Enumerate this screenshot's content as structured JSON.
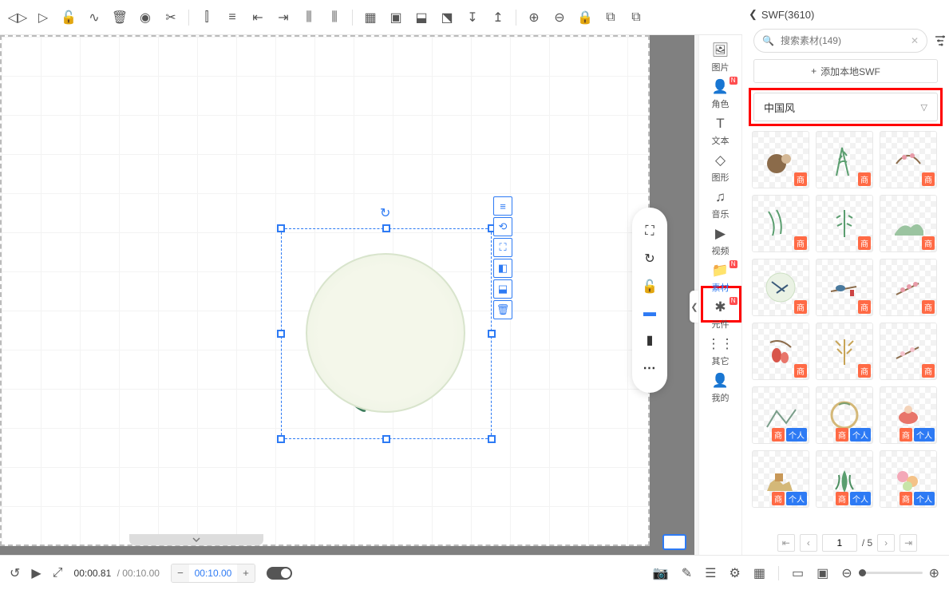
{
  "toolbar_icons": [
    "flip-h",
    "play-triangle",
    "lock-open",
    "curve",
    "trash",
    "focus",
    "crop",
    "align-v",
    "align-h",
    "indent-l",
    "indent-r",
    "distribute-h",
    "distribute-v",
    "group",
    "ungroup",
    "send-back",
    "bring-front",
    "move-back",
    "move-front",
    "zoom-in",
    "zoom-out",
    "lock",
    "copy",
    "paste"
  ],
  "right_nav": [
    {
      "icon": "🖼",
      "label": "图片"
    },
    {
      "icon": "👤",
      "label": "角色",
      "hot": "N"
    },
    {
      "icon": "T",
      "label": "文本"
    },
    {
      "icon": "◇",
      "label": "图形"
    },
    {
      "icon": "♫",
      "label": "音乐"
    },
    {
      "icon": "▶",
      "label": "视频"
    },
    {
      "icon": "📁",
      "label": "素材",
      "hot": "N",
      "active": true
    },
    {
      "icon": "✱",
      "label": "元件",
      "hot": "N"
    },
    {
      "icon": "⋮⋮",
      "label": "其它"
    },
    {
      "icon": "👤",
      "label": "我的"
    }
  ],
  "float_tools": [
    "≡",
    "⟲",
    "⛶",
    "◧",
    "⬓",
    "🗑"
  ],
  "mid_panel": [
    "⛶",
    "↻",
    "🔓",
    "▬",
    "▮",
    "⋯"
  ],
  "asset_panel": {
    "back": "SWF(3610)",
    "search_placeholder": "搜索素材(149)",
    "add_local": "添加本地SWF",
    "category": "中国风",
    "badge_shang": "商",
    "badge_geren": "个人",
    "cells": [
      {
        "shang": true
      },
      {
        "shang": true
      },
      {
        "shang": true
      },
      {
        "shang": true
      },
      {
        "shang": true
      },
      {
        "shang": true
      },
      {
        "shang": true
      },
      {
        "shang": true
      },
      {
        "shang": true
      },
      {
        "shang": true
      },
      {
        "shang": true
      },
      {
        "shang": true
      },
      {
        "shang": true,
        "geren": true
      },
      {
        "shang": true,
        "geren": true
      },
      {
        "shang": true,
        "geren": true
      },
      {
        "shang": true,
        "geren": true
      },
      {
        "shang": true,
        "geren": true
      },
      {
        "shang": true,
        "geren": true
      },
      {
        "shang": true
      },
      {
        "shang": true
      },
      {
        "shang": true
      }
    ],
    "page_current": "1",
    "page_total": "/ 5"
  },
  "bottom": {
    "time_current": "00:00.81",
    "time_total": "/ 00:10.00",
    "stepper_value": "00:10.00"
  },
  "thumb_svgs": [
    "<svg width='50' height='50'><circle cx='20' cy='30' r='12' fill='#8b6b4a'/><circle cx='32' cy='24' r='6' fill='#d4b896'/></svg>",
    "<svg width='50' height='50'><path d='M15 45 L22 10 L30 45 M18 30 Q22 25 28 28' stroke='#5a9e6f' stroke-width='2' fill='none'/><path d='M22 20 L18 25 M24 15 L28 20' stroke='#5a9e6f' stroke-width='2'/></svg>",
    "<svg width='50' height='50'><path d='M10 30 Q25 10 40 30' stroke='#8b6b4a' stroke-width='2' fill='none'/><circle cx='20' cy='22' r='3' fill='#e89ba8'/><circle cx='30' cy='20' r='3' fill='#e89ba8'/></svg>",
    "<svg width='50' height='50'><path d='M10 10 Q20 25 15 40 M20 8 Q28 22 25 38' stroke='#5a9e6f' stroke-width='2' fill='none'/></svg>",
    "<svg width='50' height='50'><path d='M25 8 L25 42 M20 15 L15 18 M30 15 L35 18 M22 25 L16 28 M28 25 L34 28' stroke='#5a9e6f' stroke-width='2'/></svg>",
    "<svg width='50' height='50'><path d='M8 38 Q18 22 28 30 Q38 20 44 34 L44 40 L8 40 Z' fill='#9bc4a0'/></svg>",
    "<svg width='50' height='50'><circle cx='25' cy='25' r='18' fill='#eaf2e4' stroke='#cde0c4'/><path d='M14 18 L30 30 M20 32 L34 22' stroke='#3a5a7a' stroke-width='2'/></svg>",
    "<svg width='50' height='50'><path d='M8 30 L40 24' stroke='#8b6b4a' stroke-width='2'/><ellipse cx='20' cy='26' rx='6' ry='4' fill='#4a7a9e'/><rect x='32' y='28' width='5' height='8' fill='#c44'/></svg>",
    "<svg width='50' height='50'><path d='M10 34 L38 20' stroke='#8b6b4a' stroke-width='2'/><circle cx='18' cy='28' r='3' fill='#e89ba8'/><circle cx='26' cy='24' r='3' fill='#e89ba8'/><circle cx='34' cy='21' r='3' fill='#e89ba8'/></svg>",
    "<svg width='50' height='50'><path d='M12 14 Q25 8 38 20' stroke='#8b6b4a' stroke-width='2' fill='none'/><ellipse cx='20' cy='30' rx='6' ry='9' fill='#d8554a'/><ellipse cx='30' cy='33' rx='5' ry='7' fill='#e8756a'/></svg>",
    "<svg width='50' height='50'><path d='M25 42 L25 10 M20 18 L14 12 M30 18 L36 12 M22 28 L16 22 M28 28 L34 22' stroke='#c8a456' stroke-width='2'/></svg>",
    "<svg width='50' height='50'><path d='M10 34 L38 20' stroke='#8b6b4a' stroke-width='2'/><circle cx='18' cy='28' r='3' fill='#f4c2cc'/><circle cx='30' cy='23' r='3' fill='#f4c2cc'/></svg>",
    "<svg width='50' height='50'><path d='M8 40 L20 20 L32 35 L44 18' stroke='#7a9e8a' stroke-width='2' fill='none'/></svg>",
    "<svg width='50' height='50'><circle cx='25' cy='25' r='16' fill='none' stroke='#d4b878' stroke-width='3'/><path d='M18 12 Q25 8 32 12' stroke='#7a9e6f' stroke-width='2' fill='none'/></svg>",
    "<svg width='50' height='50'><ellipse cx='25' cy='28' rx='12' ry='8' fill='#e8756a'/><circle cx='25' cy='18' r='5' fill='#f4d2b8'/></svg>",
    "<svg width='50' height='50'><path d='M8 40 L40 40 L36 28 L28 32 L20 24 L12 30 Z' fill='#d4b878'/><rect x='18' y='18' width='10' height='10' fill='#c89858'/></svg>",
    "<svg width='50' height='50'><path d='M25 42 Q18 28 25 14 Q32 28 25 42' fill='#5a9e6f'/><path d='M14 38 Q20 30 18 20 M36 38 Q30 30 32 20' stroke='#4a8e5f' stroke-width='2' fill='none'/></svg>",
    "<svg width='50' height='50'><circle cx='18' cy='22' r='7' fill='#f4a8b8'/><circle cx='30' cy='28' r='7' fill='#f4c288'/><circle cx='24' cy='34' r='6' fill='#c8e4a8'/></svg>"
  ]
}
